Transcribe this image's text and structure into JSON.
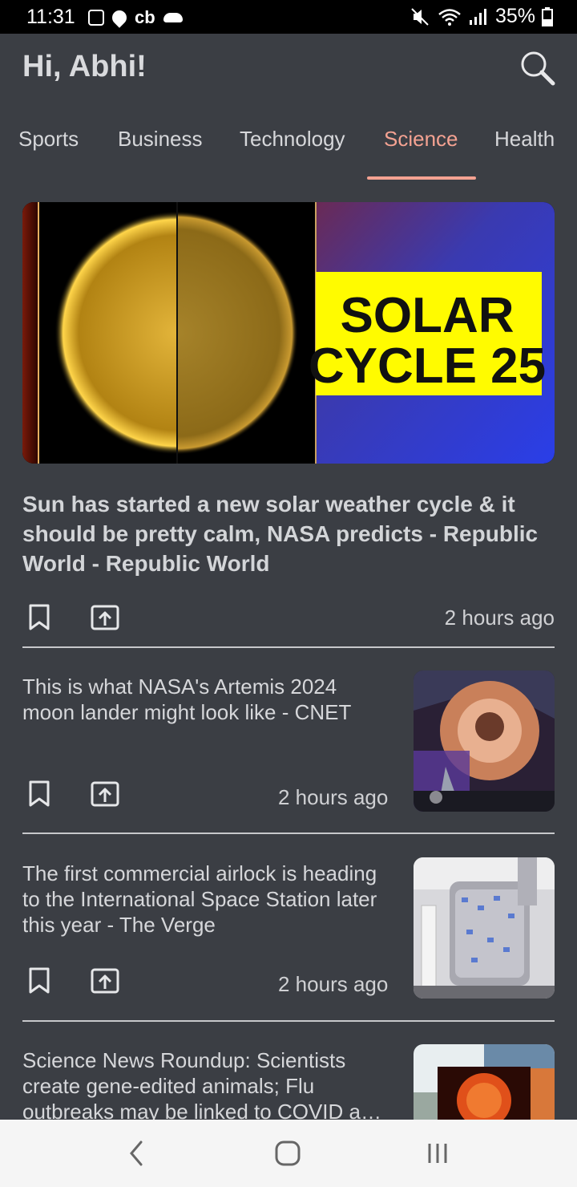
{
  "status_bar": {
    "time": "11:31",
    "carrier_badge": "cb",
    "battery": "35%"
  },
  "header": {
    "greeting": "Hi, Abhi!",
    "search_icon": "search-icon"
  },
  "tabs": [
    {
      "label": "Sports",
      "active": false
    },
    {
      "label": "Business",
      "active": false
    },
    {
      "label": "Technology",
      "active": false
    },
    {
      "label": "Science",
      "active": true
    },
    {
      "label": "Health",
      "active": false
    }
  ],
  "accent_color": "#f4a292",
  "featured": {
    "image_text_line1": "SOLAR",
    "image_text_line2": "CYCLE 25",
    "title": "Sun has started a new solar weather cycle & it should be pretty calm, NASA predicts - Republic World - Republic World",
    "time": "2 hours ago"
  },
  "articles": [
    {
      "title": "This is what NASA's Artemis 2024 moon lander might look like - CNET",
      "time": "2 hours ago"
    },
    {
      "title": "The first commercial airlock is heading to the International Space Station later this year - The Verge",
      "time": "2 hours ago"
    },
    {
      "title": "Science News Roundup: Scientists create gene-edited animals; Flu outbreaks may be linked to COVID a…",
      "time": ""
    }
  ],
  "nav": {
    "back_icon": "back-icon",
    "home_icon": "home-icon",
    "recents_icon": "recents-icon"
  }
}
